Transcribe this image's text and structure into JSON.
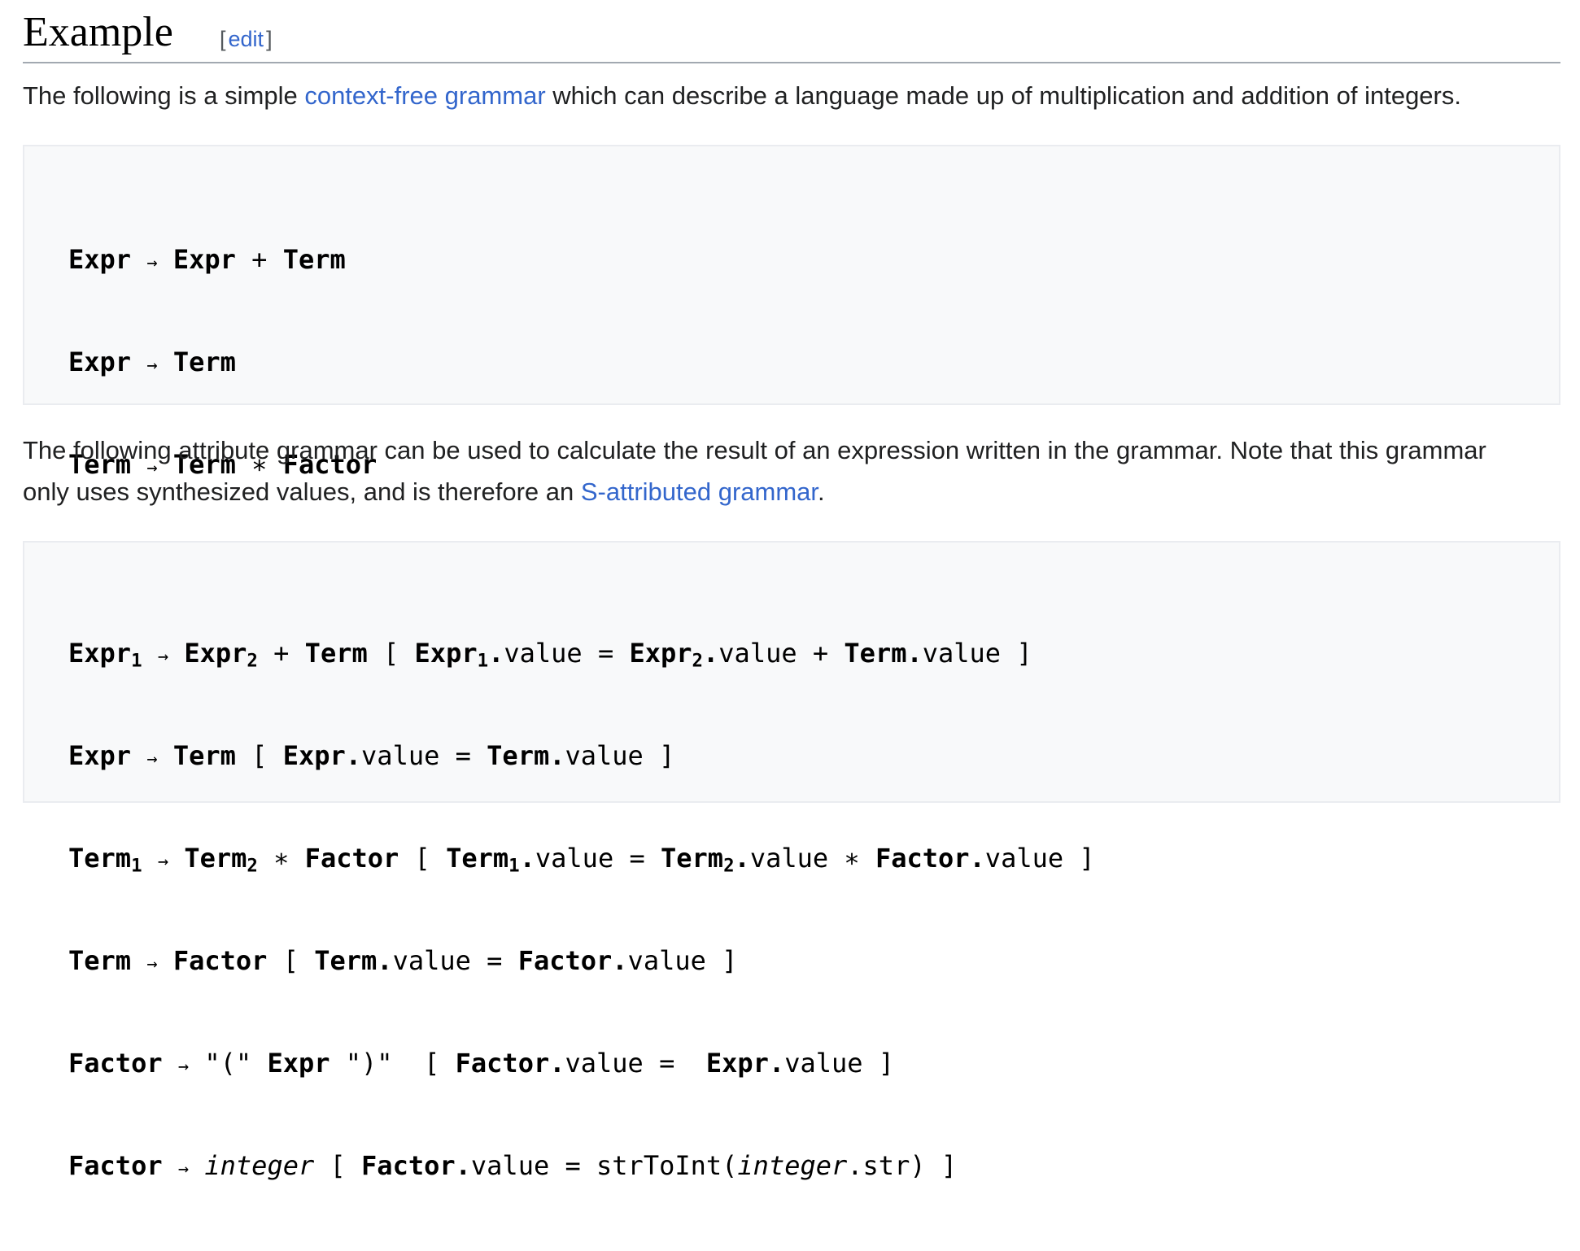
{
  "section": {
    "heading": "Example",
    "edit_open": "[",
    "edit_label": "edit",
    "edit_close": "]"
  },
  "intro": {
    "before": "The following is a simple ",
    "link": "context-free grammar",
    "after": " which can describe a language made up of multiplication and addition of integers."
  },
  "grammar": {
    "arrow": "→",
    "star": "∗",
    "plus": "+",
    "lparen": "\"(\"",
    "rparen": "\")\"",
    "expr": "Expr",
    "term": "Term",
    "factor": "Factor",
    "integer": "integer"
  },
  "attr_intro": {
    "line1": "The following attribute grammar can be used to calculate the result of an expression written in the grammar. Note that this grammar",
    "line2_before": "only uses synthesized values, and is therefore an ",
    "link": "S-attributed grammar",
    "line2_after": "."
  },
  "attr": {
    "sub1": "1",
    "sub2": "2",
    "value": "value",
    "dot": ".",
    "lb": "[",
    "rb": "]",
    "eq": "=",
    "func": "strToInt(",
    "str": ".str)"
  }
}
